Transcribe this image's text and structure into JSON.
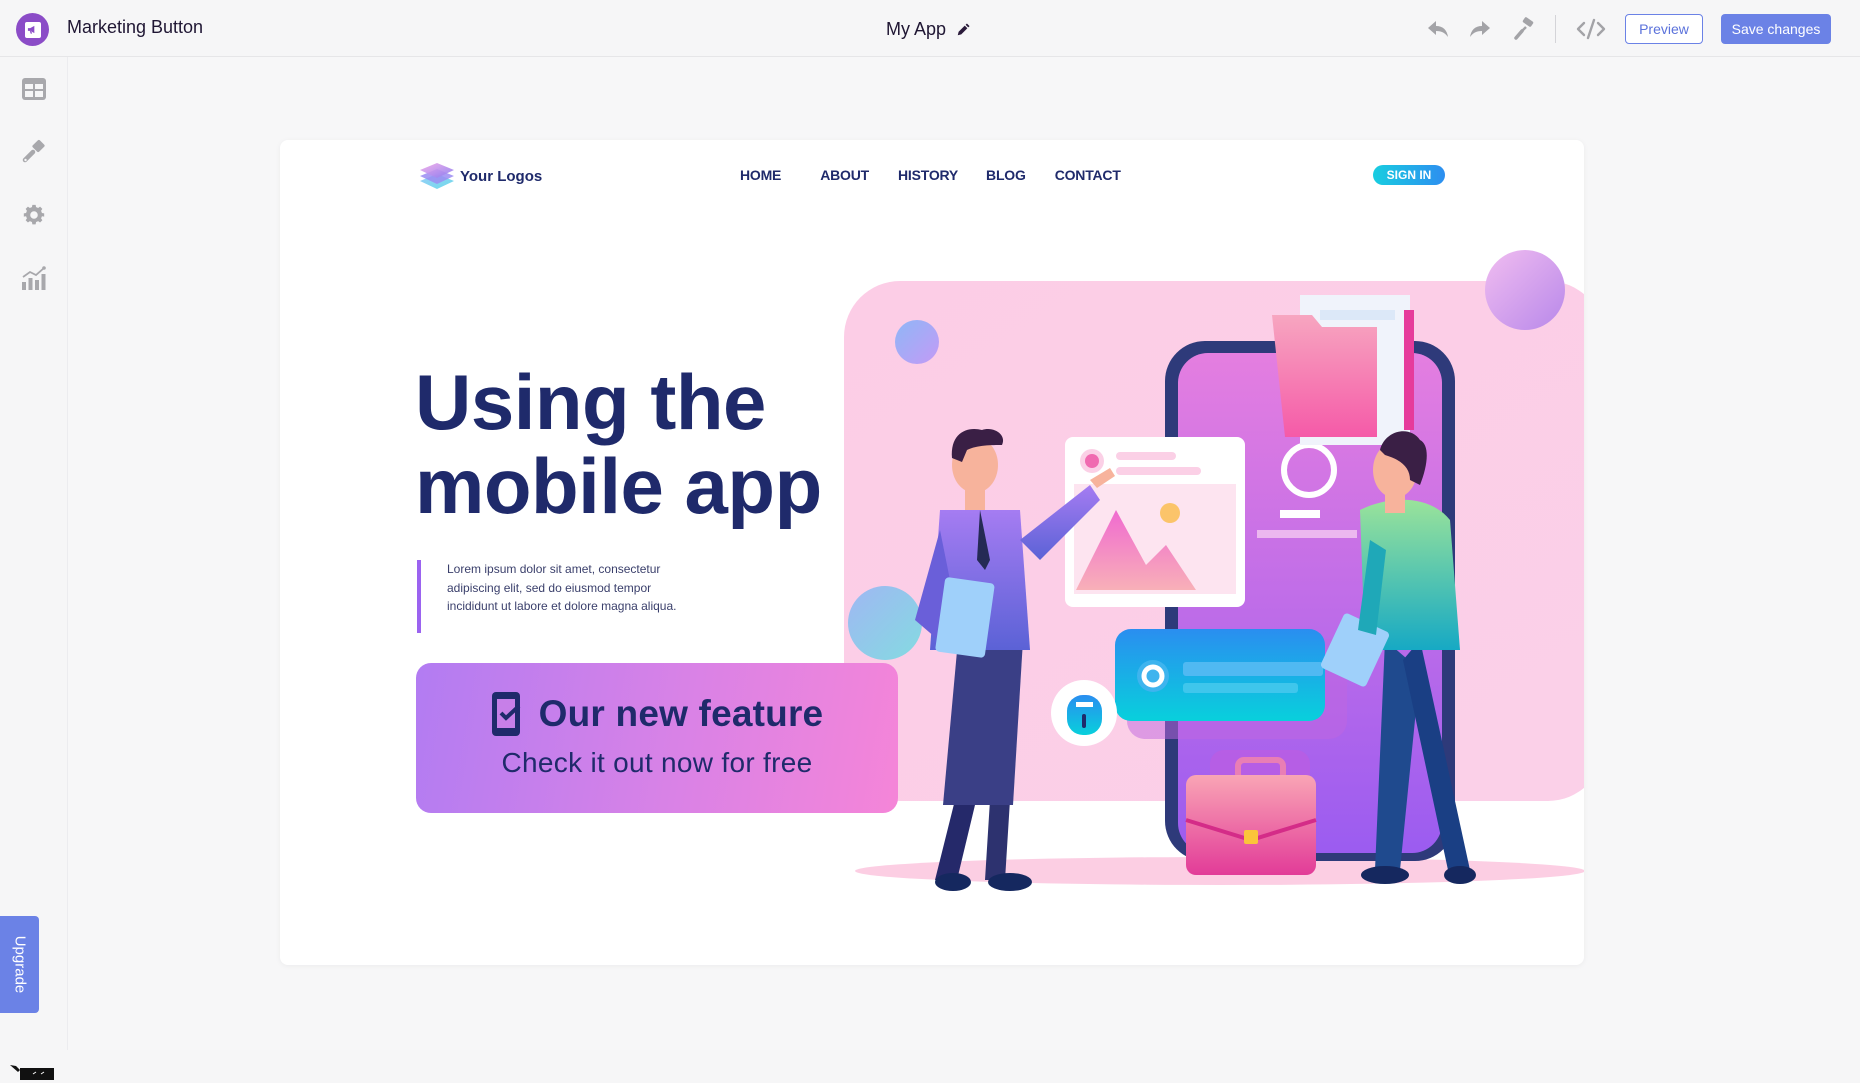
{
  "topbar": {
    "app_title": "Marketing Button",
    "center_title": "My App",
    "preview_label": "Preview",
    "save_label": "Save changes",
    "icons": [
      "undo-icon",
      "redo-icon",
      "paint-roller-icon",
      "code-icon"
    ]
  },
  "sidebar": {
    "items": [
      {
        "name": "layout-icon"
      },
      {
        "name": "brush-icon"
      },
      {
        "name": "settings-icon"
      },
      {
        "name": "analytics-icon"
      }
    ],
    "upgrade_label": "Upgrade"
  },
  "preview": {
    "logo_text": "Your Logos",
    "nav": [
      "HOME",
      "ABOUT",
      "HISTORY",
      "BLOG",
      "CONTACT"
    ],
    "signin_label": "SIGN IN",
    "headline_line1": "Using the",
    "headline_line2": "mobile app",
    "paragraph_line1": "Lorem ipsum dolor sit amet, consectetur",
    "paragraph_line2": "adipiscing elit, sed do eiusmod tempor",
    "paragraph_line3": "incididunt ut labore et dolore magna aliqua.",
    "feature_button": {
      "title": "Our new feature",
      "subtitle": "Check it out now for free",
      "icon": "mobile-check-icon"
    }
  },
  "colors": {
    "accent": "#6b82e6",
    "brand_purple": "#8b4cc7",
    "headline": "#1f2a6b",
    "feature_gradient_start": "#b27cf2",
    "feature_gradient_end": "#f585d8",
    "signin_gradient_start": "#18cde0",
    "signin_gradient_end": "#2d8ef0"
  }
}
